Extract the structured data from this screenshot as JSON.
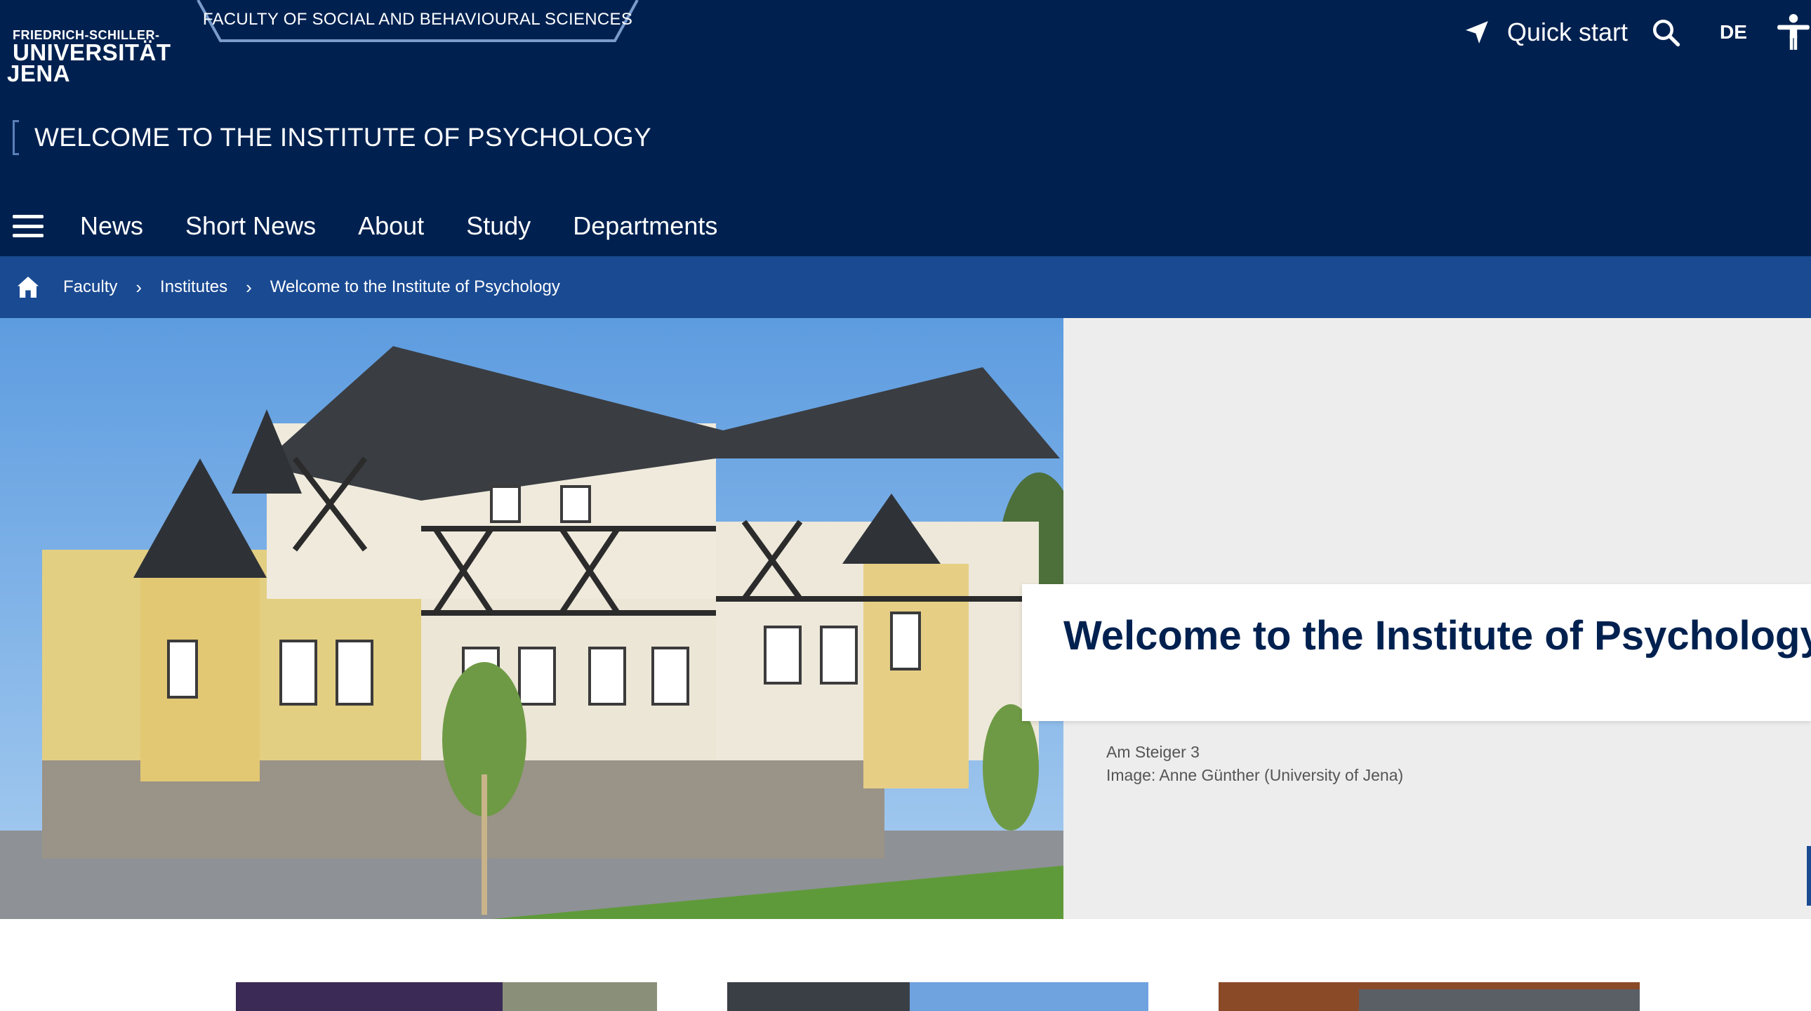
{
  "logo": {
    "line1": "FRIEDRICH-SCHILLER-",
    "line2": "UNIVERSITÄT",
    "line3": "JENA"
  },
  "faculty_tab": "FACULTY OF SOCIAL AND BEHAVIOURAL SCIENCES",
  "utility": {
    "quick_start": "Quick start",
    "language": "DE"
  },
  "institute_title": "WELCOME TO THE INSTITUTE OF PSYCHOLOGY",
  "main_nav": [
    {
      "label": "News"
    },
    {
      "label": "Short News"
    },
    {
      "label": "About"
    },
    {
      "label": "Study"
    },
    {
      "label": "Departments"
    }
  ],
  "breadcrumb": [
    {
      "label": "Faculty"
    },
    {
      "label": "Institutes"
    },
    {
      "label": "Welcome to the Institute of Psychology"
    }
  ],
  "hero": {
    "heading": "Welcome to the Institute of Psychology",
    "caption_line1": "Am Steiger 3",
    "caption_line2": "Image: Anne Günther (University of Jena)"
  },
  "colors": {
    "header_bg": "#002150",
    "breadcrumb_bg": "#1a4a92",
    "heading": "#002150",
    "hero_panel_bg": "#ededed"
  },
  "icons": [
    "quick-start-icon",
    "search-icon",
    "accessibility-icon",
    "menu-icon",
    "home-icon",
    "chevron-right-icon"
  ]
}
